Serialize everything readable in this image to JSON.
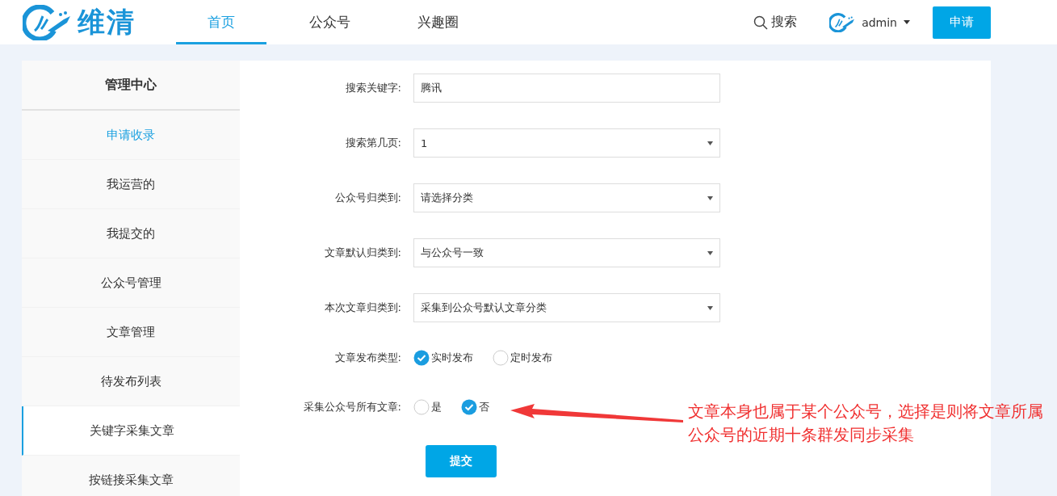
{
  "header": {
    "logo_text": "维清",
    "nav": [
      {
        "label": "首页",
        "selected": true
      },
      {
        "label": "公众号",
        "selected": false
      },
      {
        "label": "兴趣圈",
        "selected": false
      }
    ],
    "search_label": "搜索",
    "user": "admin",
    "apply_button": "申请"
  },
  "sidebar": {
    "title": "管理中心",
    "items": [
      {
        "label": "申请收录",
        "highlighted": true,
        "selected": false
      },
      {
        "label": "我运营的",
        "highlighted": false,
        "selected": false
      },
      {
        "label": "我提交的",
        "highlighted": false,
        "selected": false
      },
      {
        "label": "公众号管理",
        "highlighted": false,
        "selected": false
      },
      {
        "label": "文章管理",
        "highlighted": false,
        "selected": false
      },
      {
        "label": "待发布列表",
        "highlighted": false,
        "selected": false
      },
      {
        "label": "关键字采集文章",
        "highlighted": false,
        "selected": true
      },
      {
        "label": "按链接采集文章",
        "highlighted": false,
        "selected": false
      }
    ]
  },
  "form": {
    "fields": [
      {
        "kind": "text",
        "label": "搜索关键字:",
        "value": "腾讯"
      },
      {
        "kind": "select",
        "label": "搜索第几页:",
        "value": "1"
      },
      {
        "kind": "select",
        "label": "公众号归类到:",
        "value": "请选择分类"
      },
      {
        "kind": "select",
        "label": "文章默认归类到:",
        "value": "与公众号一致"
      },
      {
        "kind": "select",
        "label": "本次文章归类到:",
        "value": "采集到公众号默认文章分类"
      },
      {
        "kind": "radio",
        "label": "文章发布类型:",
        "options": [
          {
            "label": "实时发布",
            "selected": true
          },
          {
            "label": "定时发布",
            "selected": false
          }
        ]
      },
      {
        "kind": "radio",
        "label": "采集公众号所有文章:",
        "options": [
          {
            "label": "是",
            "selected": false
          },
          {
            "label": "否",
            "selected": true
          }
        ]
      }
    ],
    "submit": "提交"
  },
  "annotation": {
    "text": "文章本身也属于某个公众号，选择是则将文章所属公众号的近期十条群发同步采集"
  }
}
